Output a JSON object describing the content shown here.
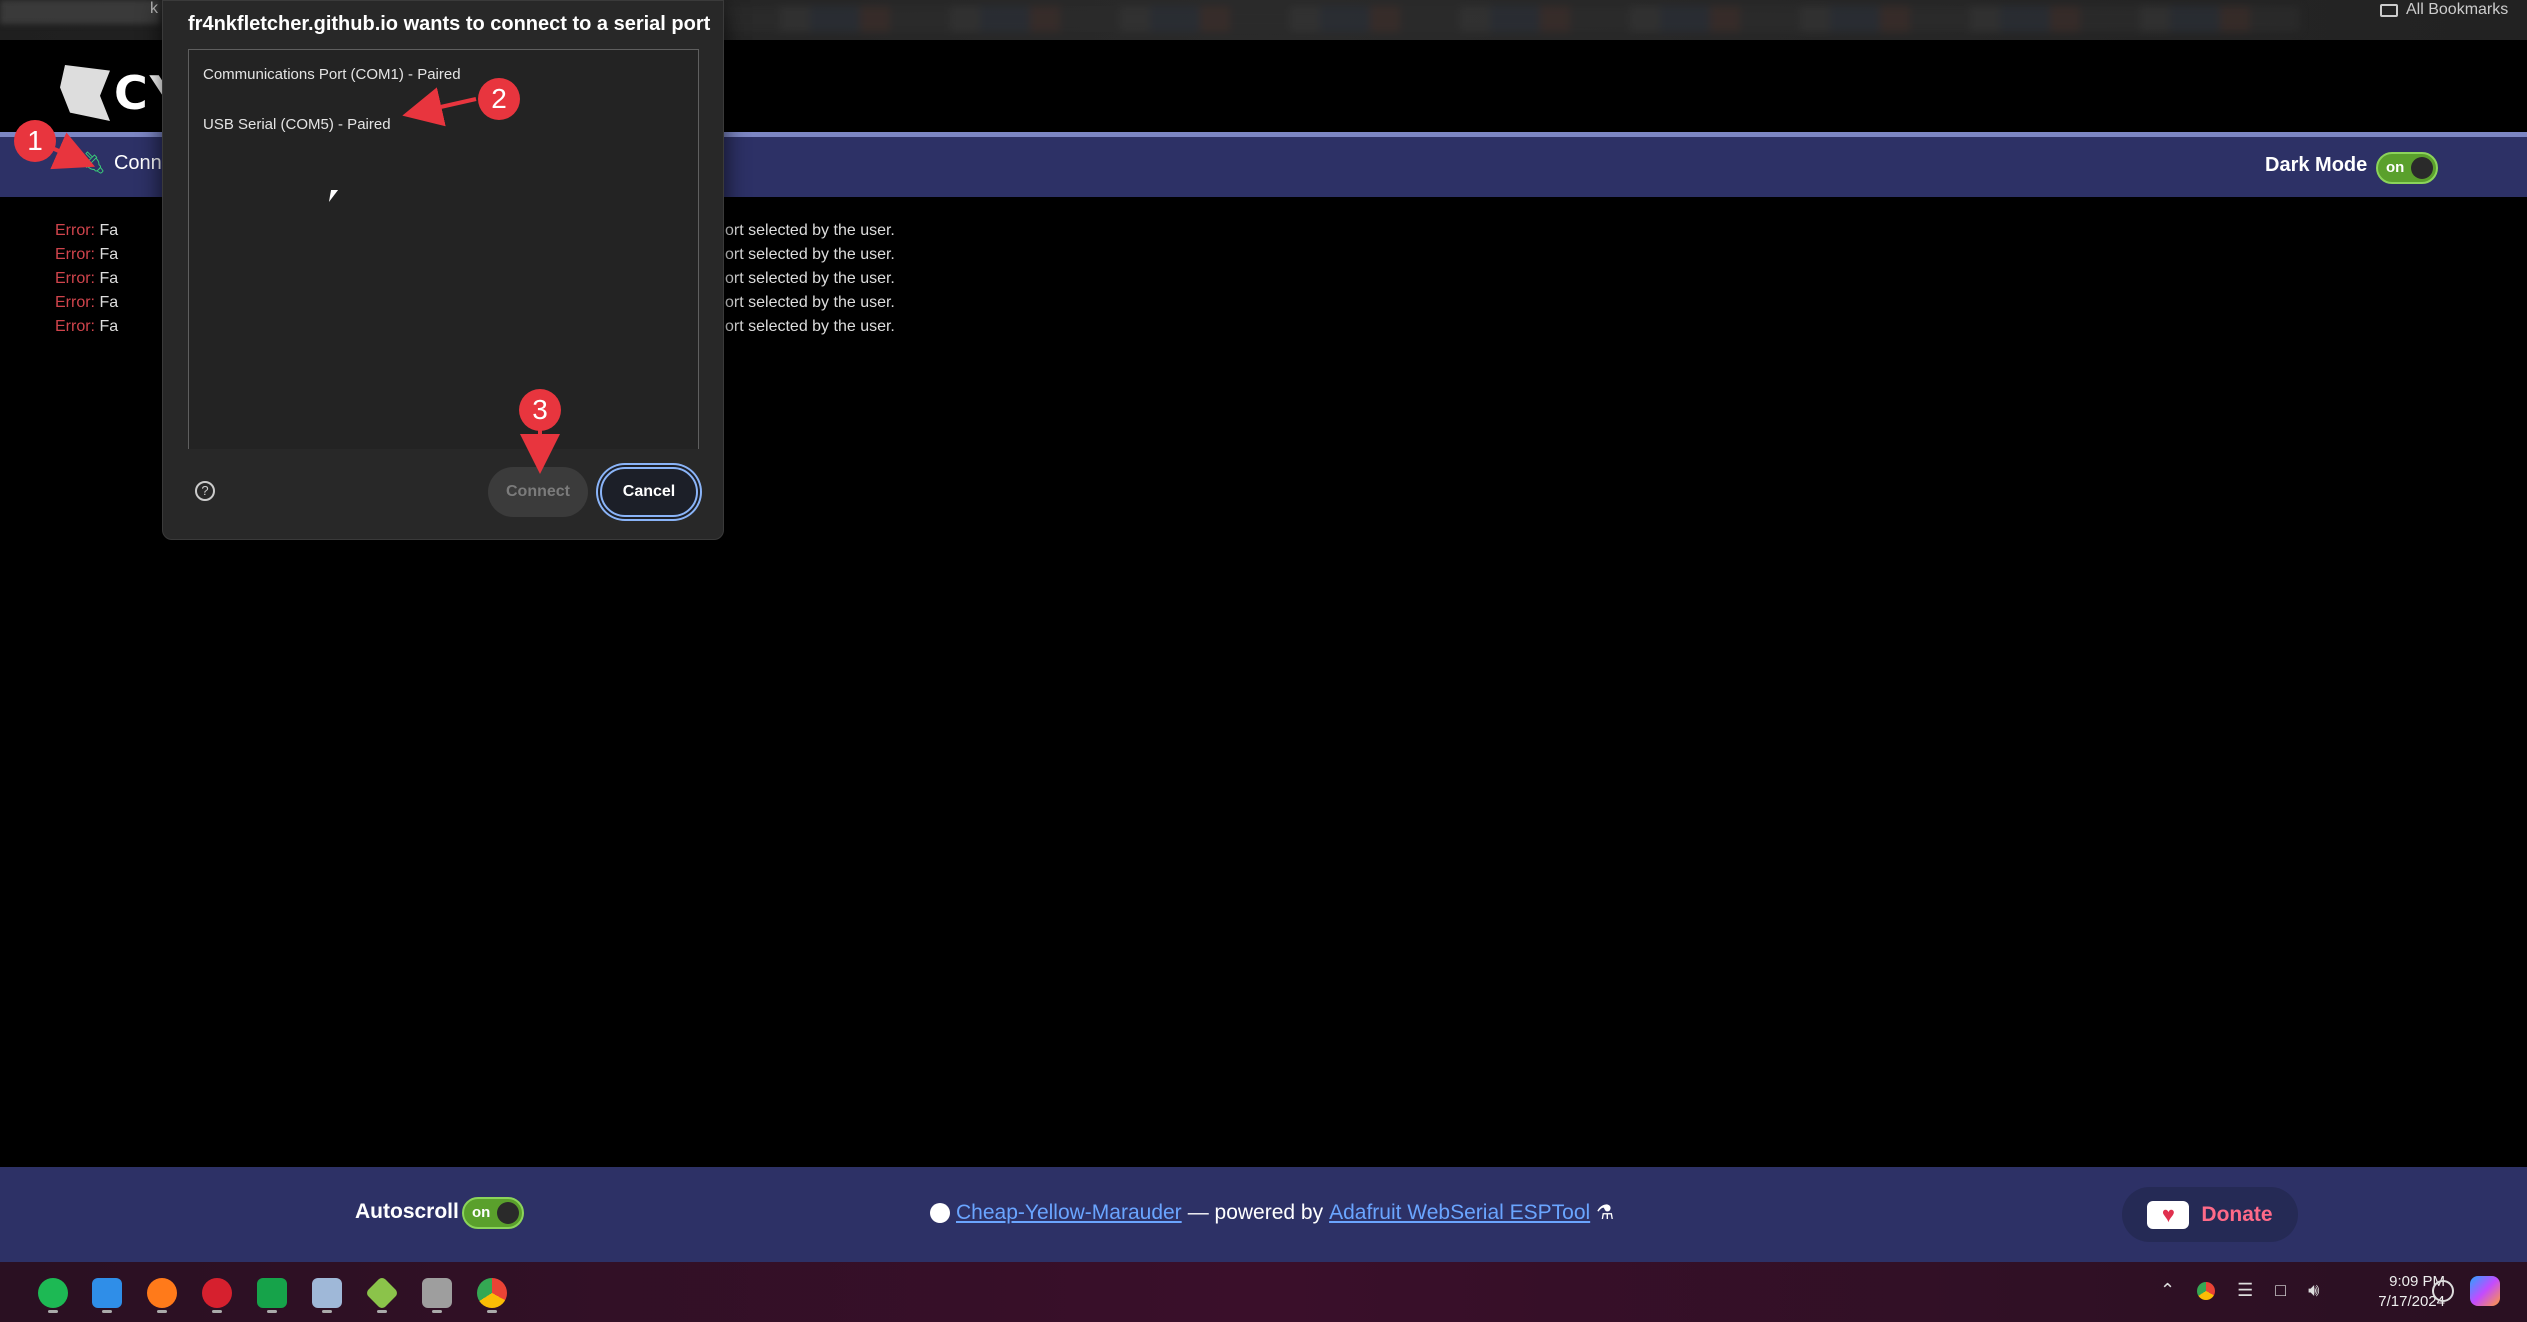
{
  "browser": {
    "tab_fragment": "k",
    "bookmarks_label": "All Bookmarks"
  },
  "site": {
    "logo_text": "CY",
    "connect_label": "Connec",
    "dark_mode_label": "Dark Mode",
    "dark_mode_state": "on"
  },
  "terminal": {
    "lines": [
      {
        "label": "Error:",
        "head": "Fa",
        "tail": "ort selected by the user."
      },
      {
        "label": "Error:",
        "head": "Fa",
        "tail": "ort selected by the user."
      },
      {
        "label": "Error:",
        "head": "Fa",
        "tail": "ort selected by the user."
      },
      {
        "label": "Error:",
        "head": "Fa",
        "tail": "ort selected by the user."
      },
      {
        "label": "Error:",
        "head": "Fa",
        "tail": "ort selected by the user."
      }
    ]
  },
  "dialog": {
    "title": "fr4nkfletcher.github.io wants to connect to a serial port",
    "ports": [
      "Communications Port (COM1) - Paired",
      "USB Serial (COM5) - Paired"
    ],
    "help_glyph": "?",
    "connect_label": "Connect",
    "cancel_label": "Cancel"
  },
  "callouts": [
    "1",
    "2",
    "3"
  ],
  "footer": {
    "autoscroll_label": "Autoscroll",
    "autoscroll_state": "on",
    "repo_link": "Cheap-Yellow-Marauder",
    "powered_by_text": "— powered by",
    "tool_link": "Adafruit WebSerial ESPTool",
    "donate_label": "Donate"
  },
  "taskbar": {
    "apps": [
      "spotify-icon",
      "vscode-icon",
      "firefox-icon",
      "app-red-icon",
      "sheets-icon",
      "image-viewer-icon",
      "cube-icon",
      "tools-icon",
      "chrome-icon"
    ],
    "time": "9:09 PM",
    "date": "7/17/2024"
  },
  "colors": {
    "navbar": "#2d3166",
    "error_label": "#d0444c",
    "toggle_on": "#5aa02c",
    "link": "#6aa5ff",
    "callout": "#e8353e"
  }
}
